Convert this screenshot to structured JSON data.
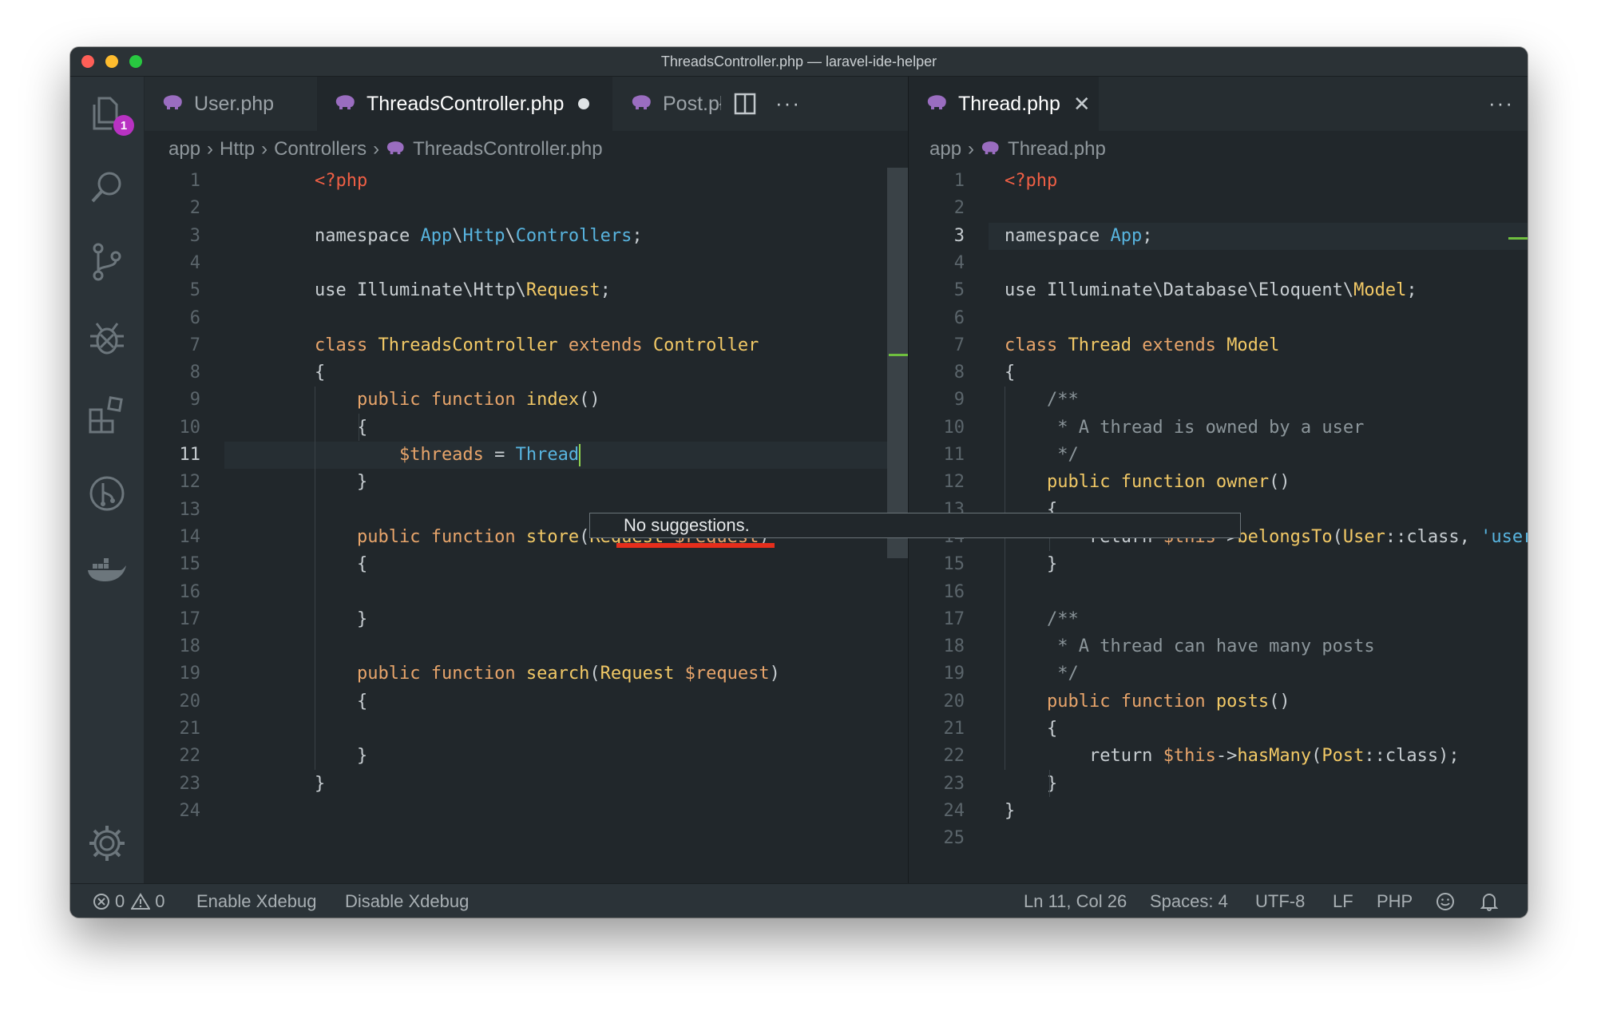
{
  "window": {
    "title": "ThreadsController.php — laravel-ide-helper"
  },
  "activity": {
    "explorer_badge": "1",
    "icons": [
      "files-icon",
      "search-icon",
      "source-control-icon",
      "debug-icon",
      "extensions-icon",
      "git-graph-icon",
      "docker-icon",
      "gear-icon"
    ]
  },
  "left_pane": {
    "tabs": [
      {
        "label": "User.php",
        "active": false
      },
      {
        "label": "ThreadsController.php",
        "active": true,
        "modified": true
      },
      {
        "label": "Post.pł",
        "active": false
      }
    ],
    "breadcrumb": [
      "app",
      "Http",
      "Controllers",
      "ThreadsController.php"
    ],
    "lines": [
      {
        "n": "1",
        "tokens": [
          {
            "t": "<?php",
            "c": "tag"
          }
        ]
      },
      {
        "n": "2",
        "tokens": []
      },
      {
        "n": "3",
        "tokens": [
          {
            "t": "namespace ",
            "c": "plain"
          },
          {
            "t": "App",
            "c": "ns"
          },
          {
            "t": "\\",
            "c": "plain"
          },
          {
            "t": "Http",
            "c": "ns"
          },
          {
            "t": "\\",
            "c": "plain"
          },
          {
            "t": "Controllers",
            "c": "ns"
          },
          {
            "t": ";",
            "c": "plain"
          }
        ]
      },
      {
        "n": "4",
        "tokens": []
      },
      {
        "n": "5",
        "tokens": [
          {
            "t": "use ",
            "c": "plain"
          },
          {
            "t": "Illuminate\\Http\\",
            "c": "plain"
          },
          {
            "t": "Request",
            "c": "cls"
          },
          {
            "t": ";",
            "c": "plain"
          }
        ]
      },
      {
        "n": "6",
        "tokens": []
      },
      {
        "n": "7",
        "tokens": [
          {
            "t": "class ",
            "c": "kw"
          },
          {
            "t": "ThreadsController",
            "c": "cls"
          },
          {
            "t": " extends ",
            "c": "kw"
          },
          {
            "t": "Controller",
            "c": "cls"
          }
        ]
      },
      {
        "n": "8",
        "tokens": [
          {
            "t": "{",
            "c": "plain"
          }
        ]
      },
      {
        "n": "9",
        "tokens": [
          {
            "t": "    public ",
            "c": "kw"
          },
          {
            "t": "function ",
            "c": "kw"
          },
          {
            "t": "index",
            "c": "fn"
          },
          {
            "t": "()",
            "c": "plain"
          }
        ]
      },
      {
        "n": "10",
        "tokens": [
          {
            "t": "    {",
            "c": "plain"
          }
        ]
      },
      {
        "n": "11",
        "tokens": [
          {
            "t": "        $threads",
            "c": "var"
          },
          {
            "t": " = ",
            "c": "plain"
          },
          {
            "t": "Thread",
            "c": "ns"
          }
        ],
        "current": true
      },
      {
        "n": "12",
        "tokens": [
          {
            "t": "    }",
            "c": "plain"
          }
        ]
      },
      {
        "n": "13",
        "tokens": []
      },
      {
        "n": "14",
        "tokens": [
          {
            "t": "    public ",
            "c": "kw"
          },
          {
            "t": "function ",
            "c": "kw"
          },
          {
            "t": "store",
            "c": "fn"
          },
          {
            "t": "(",
            "c": "plain"
          },
          {
            "t": "Request ",
            "c": "cls"
          },
          {
            "t": "$request",
            "c": "var"
          },
          {
            "t": ")",
            "c": "plain"
          }
        ]
      },
      {
        "n": "15",
        "tokens": [
          {
            "t": "    {",
            "c": "plain"
          }
        ]
      },
      {
        "n": "16",
        "tokens": []
      },
      {
        "n": "17",
        "tokens": [
          {
            "t": "    }",
            "c": "plain"
          }
        ]
      },
      {
        "n": "18",
        "tokens": []
      },
      {
        "n": "19",
        "tokens": [
          {
            "t": "    public ",
            "c": "kw"
          },
          {
            "t": "function ",
            "c": "kw"
          },
          {
            "t": "search",
            "c": "fn"
          },
          {
            "t": "(",
            "c": "plain"
          },
          {
            "t": "Request ",
            "c": "cls"
          },
          {
            "t": "$request",
            "c": "var"
          },
          {
            "t": ")",
            "c": "plain"
          }
        ]
      },
      {
        "n": "20",
        "tokens": [
          {
            "t": "    {",
            "c": "plain"
          }
        ]
      },
      {
        "n": "21",
        "tokens": []
      },
      {
        "n": "22",
        "tokens": [
          {
            "t": "    }",
            "c": "plain"
          }
        ]
      },
      {
        "n": "23",
        "tokens": [
          {
            "t": "}",
            "c": "plain"
          }
        ]
      },
      {
        "n": "24",
        "tokens": []
      }
    ]
  },
  "right_pane": {
    "tabs": [
      {
        "label": "Thread.php",
        "active": true
      }
    ],
    "breadcrumb": [
      "app",
      "Thread.php"
    ],
    "lines": [
      {
        "n": "1",
        "tokens": [
          {
            "t": "<?php",
            "c": "tag"
          }
        ]
      },
      {
        "n": "2",
        "tokens": []
      },
      {
        "n": "3",
        "tokens": [
          {
            "t": "namespace ",
            "c": "plain"
          },
          {
            "t": "App",
            "c": "ns"
          },
          {
            "t": ";",
            "c": "plain"
          }
        ],
        "current": true
      },
      {
        "n": "4",
        "tokens": []
      },
      {
        "n": "5",
        "tokens": [
          {
            "t": "use ",
            "c": "plain"
          },
          {
            "t": "Illuminate\\Database\\Eloquent\\",
            "c": "plain"
          },
          {
            "t": "Model",
            "c": "cls"
          },
          {
            "t": ";",
            "c": "plain"
          }
        ]
      },
      {
        "n": "6",
        "tokens": []
      },
      {
        "n": "7",
        "tokens": [
          {
            "t": "class ",
            "c": "kw"
          },
          {
            "t": "Thread",
            "c": "cls"
          },
          {
            "t": " extends ",
            "c": "kw"
          },
          {
            "t": "Model",
            "c": "cls"
          }
        ]
      },
      {
        "n": "8",
        "tokens": [
          {
            "t": "{",
            "c": "plain"
          }
        ]
      },
      {
        "n": "9",
        "tokens": [
          {
            "t": "    /**",
            "c": "cm"
          }
        ]
      },
      {
        "n": "10",
        "tokens": [
          {
            "t": "     * A thread is owned by a user",
            "c": "cm"
          }
        ]
      },
      {
        "n": "11",
        "tokens": [
          {
            "t": "     */",
            "c": "cm"
          }
        ]
      },
      {
        "n": "12",
        "tokens": [
          {
            "t": "    public function owner",
            "c": "fn"
          },
          {
            "t": "()",
            "c": "plain"
          }
        ]
      },
      {
        "n": "13",
        "tokens": [
          {
            "t": "    {",
            "c": "plain"
          }
        ]
      },
      {
        "n": "14",
        "tokens": [
          {
            "t": "        return ",
            "c": "plain"
          },
          {
            "t": "$this",
            "c": "var"
          },
          {
            "t": "->",
            "c": "plain"
          },
          {
            "t": "belongsTo",
            "c": "fn"
          },
          {
            "t": "(",
            "c": "plain"
          },
          {
            "t": "User",
            "c": "cls"
          },
          {
            "t": "::class, ",
            "c": "plain"
          },
          {
            "t": "'user_id'",
            "c": "str"
          }
        ]
      },
      {
        "n": "15",
        "tokens": [
          {
            "t": "    }",
            "c": "plain"
          }
        ]
      },
      {
        "n": "16",
        "tokens": []
      },
      {
        "n": "17",
        "tokens": [
          {
            "t": "    /**",
            "c": "cm"
          }
        ]
      },
      {
        "n": "18",
        "tokens": [
          {
            "t": "     * A thread can have many posts",
            "c": "cm"
          }
        ]
      },
      {
        "n": "19",
        "tokens": [
          {
            "t": "     */",
            "c": "cm"
          }
        ]
      },
      {
        "n": "20",
        "tokens": [
          {
            "t": "    public ",
            "c": "kw"
          },
          {
            "t": "function ",
            "c": "kw"
          },
          {
            "t": "posts",
            "c": "fn"
          },
          {
            "t": "()",
            "c": "plain"
          }
        ]
      },
      {
        "n": "21",
        "tokens": [
          {
            "t": "    {",
            "c": "plain"
          }
        ]
      },
      {
        "n": "22",
        "tokens": [
          {
            "t": "        return ",
            "c": "plain"
          },
          {
            "t": "$this",
            "c": "var"
          },
          {
            "t": "->",
            "c": "plain"
          },
          {
            "t": "hasMany",
            "c": "fn"
          },
          {
            "t": "(",
            "c": "plain"
          },
          {
            "t": "Post",
            "c": "cls"
          },
          {
            "t": "::class);",
            "c": "plain"
          }
        ]
      },
      {
        "n": "23",
        "tokens": [
          {
            "t": "    }",
            "c": "plain"
          }
        ]
      },
      {
        "n": "24",
        "tokens": [
          {
            "t": "}",
            "c": "plain"
          }
        ]
      },
      {
        "n": "25",
        "tokens": []
      }
    ]
  },
  "suggest": {
    "text": "No suggestions."
  },
  "status": {
    "errors": "0",
    "warnings": "0",
    "enable_xdebug": "Enable Xdebug",
    "disable_xdebug": "Disable Xdebug",
    "position": "Ln 11, Col 26",
    "spaces": "Spaces: 4",
    "encoding": "UTF-8",
    "eol": "LF",
    "language": "PHP"
  }
}
